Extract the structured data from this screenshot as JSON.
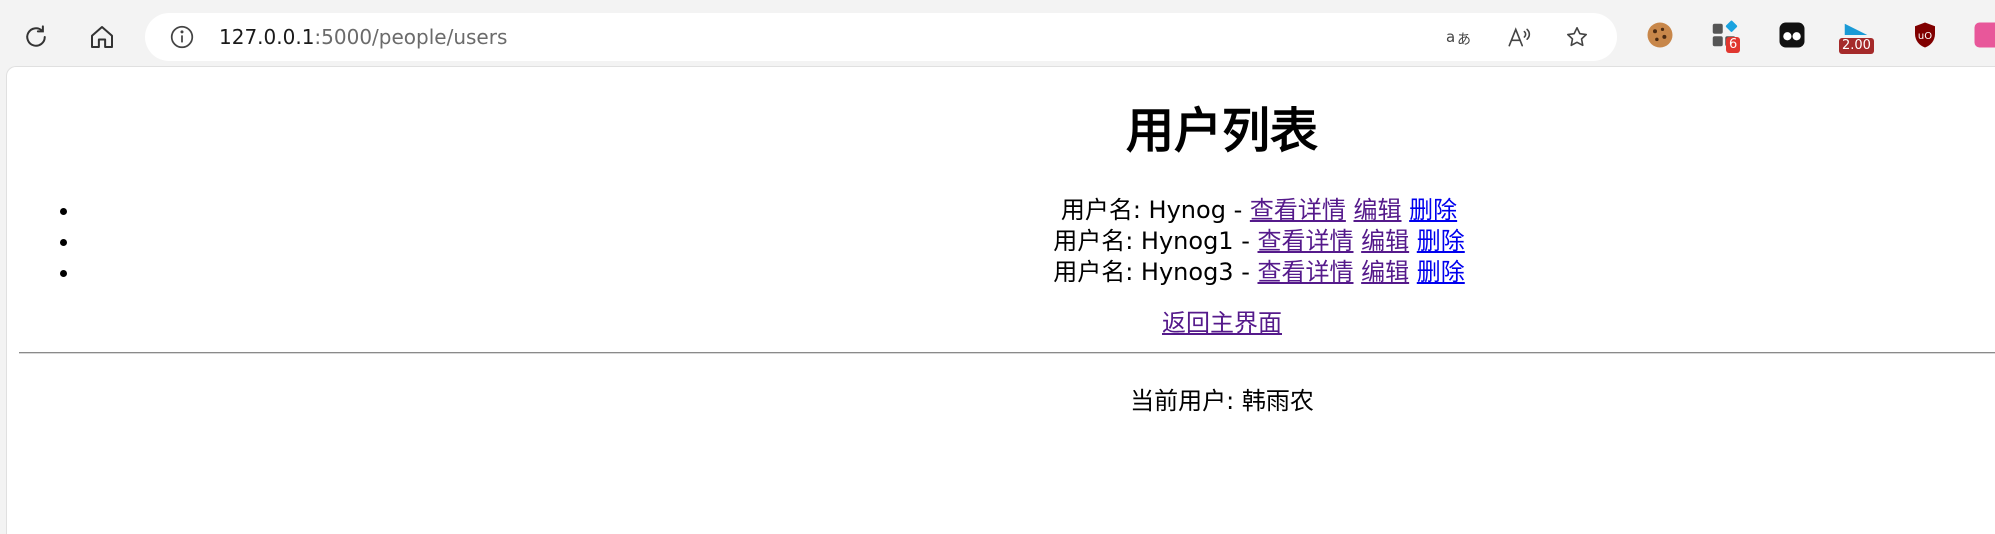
{
  "browser": {
    "url_host": "127.0.0.1",
    "url_rest": ":5000/people/users",
    "extension_badges": {
      "extension_2_count": "6",
      "extension_4_value": "2.00"
    },
    "colors": {
      "toolbar_bg": "#f3f3f3",
      "badge_red": "#e0372f",
      "badge_dark_red": "#a52a2a"
    }
  },
  "page": {
    "title": "用户列表",
    "users": [
      {
        "prefix": "用户名: Hynog - ",
        "detail_label": "查看详情",
        "edit_label": "编辑",
        "delete_label": "删除"
      },
      {
        "prefix": "用户名: Hynog1 - ",
        "detail_label": "查看详情",
        "edit_label": "编辑",
        "delete_label": "删除"
      },
      {
        "prefix": "用户名: Hynog3 - ",
        "detail_label": "查看详情",
        "edit_label": "编辑",
        "delete_label": "删除"
      }
    ],
    "back_link": "返回主界面",
    "current_user": "当前用户: 韩雨农",
    "colors": {
      "link": "#0000ee",
      "visited_link": "#551a8b"
    }
  }
}
